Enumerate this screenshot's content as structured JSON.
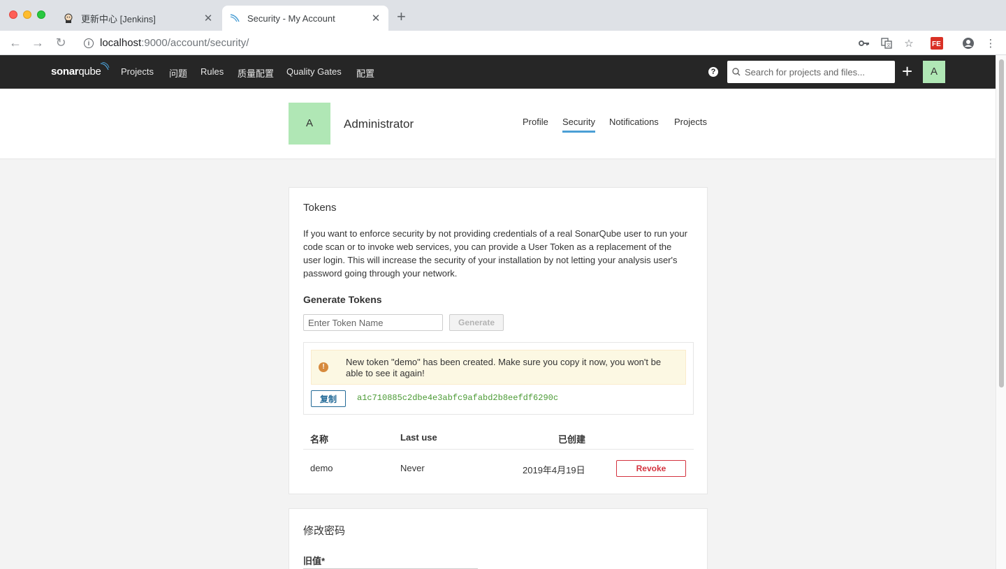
{
  "browser": {
    "tabs": [
      {
        "title": "更新中心 [Jenkins]",
        "active": false
      },
      {
        "title": "Security - My Account",
        "active": true
      }
    ],
    "url": {
      "host": "localhost",
      "rest": ":9000/account/security/"
    }
  },
  "nav": {
    "logo": {
      "sonar": "sonar",
      "qube": "qube"
    },
    "items": [
      "Projects",
      "问题",
      "Rules",
      "质量配置",
      "Quality Gates",
      "配置"
    ],
    "search_placeholder": "Search for projects and files...",
    "avatar_letter": "A",
    "help": "?"
  },
  "account": {
    "avatar_letter": "A",
    "name": "Administrator",
    "tabs": [
      {
        "label": "Profile",
        "active": false
      },
      {
        "label": "Security",
        "active": true
      },
      {
        "label": "Notifications",
        "active": false
      },
      {
        "label": "Projects",
        "active": false
      }
    ]
  },
  "tokens": {
    "title": "Tokens",
    "description": "If you want to enforce security by not providing credentials of a real SonarQube user to run your code scan or to invoke web services, you can provide a User Token as a replacement of the user login. This will increase the security of your installation by not letting your analysis user's password going through your network.",
    "generate_title": "Generate Tokens",
    "input_placeholder": "Enter Token Name",
    "generate_label": "Generate",
    "alert_message": "New token \"demo\" has been created. Make sure you copy it now, you won't be able to see it again!",
    "copy_label": "复制",
    "token_value": "a1c710885c2dbe4e3abfc9afabd2b8eefdf6290c",
    "table": {
      "headers": [
        "名称",
        "Last use",
        "已创建"
      ],
      "rows": [
        {
          "name": "demo",
          "last_use": "Never",
          "created": "2019年4月19日",
          "action": "Revoke"
        }
      ]
    }
  },
  "password": {
    "title": "修改密码",
    "old_label": "旧值*"
  },
  "colors": {
    "nav_bg": "#262626",
    "avatar_bg": "#b0e7b5",
    "active_tab_underline": "#4b9fd5",
    "revoke": "#d4333f",
    "token_green": "#4a9a34",
    "alert_bg": "#fcf8e3"
  }
}
